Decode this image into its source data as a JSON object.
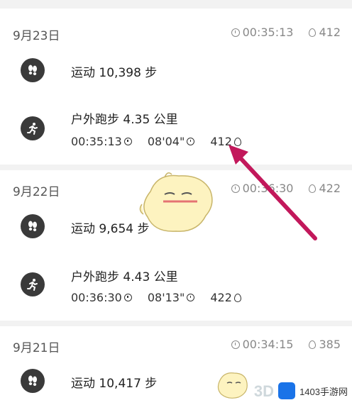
{
  "days": [
    {
      "date": "9月23日",
      "total_time": "00:35:13",
      "total_cal": "412",
      "activities": [
        {
          "type": "steps",
          "title": "运动 10,398 步"
        },
        {
          "type": "run",
          "title": "户外跑步 4.35 公里",
          "duration": "00:35:13",
          "pace": "08'04\"",
          "calories": "412"
        }
      ]
    },
    {
      "date": "9月22日",
      "total_time": "00:36:30",
      "total_cal": "422",
      "activities": [
        {
          "type": "steps",
          "title": "运动 9,654 步"
        },
        {
          "type": "run",
          "title": "户外跑步 4.43 公里",
          "duration": "00:36:30",
          "pace": "08'13\"",
          "calories": "422"
        }
      ]
    },
    {
      "date": "9月21日",
      "total_time": "00:34:15",
      "total_cal": "385",
      "activities": [
        {
          "type": "steps",
          "title": "运动 10,417 步"
        }
      ]
    }
  ],
  "watermark": {
    "brand": "1403手游网",
    "site": "3D"
  },
  "icons": {
    "steps": "footprints-icon",
    "run": "runner-icon",
    "clock": "clock-icon",
    "fire": "flame-icon"
  },
  "colors": {
    "annotation_arrow": "#c2185b",
    "icon_bg": "#3a3a3a"
  }
}
